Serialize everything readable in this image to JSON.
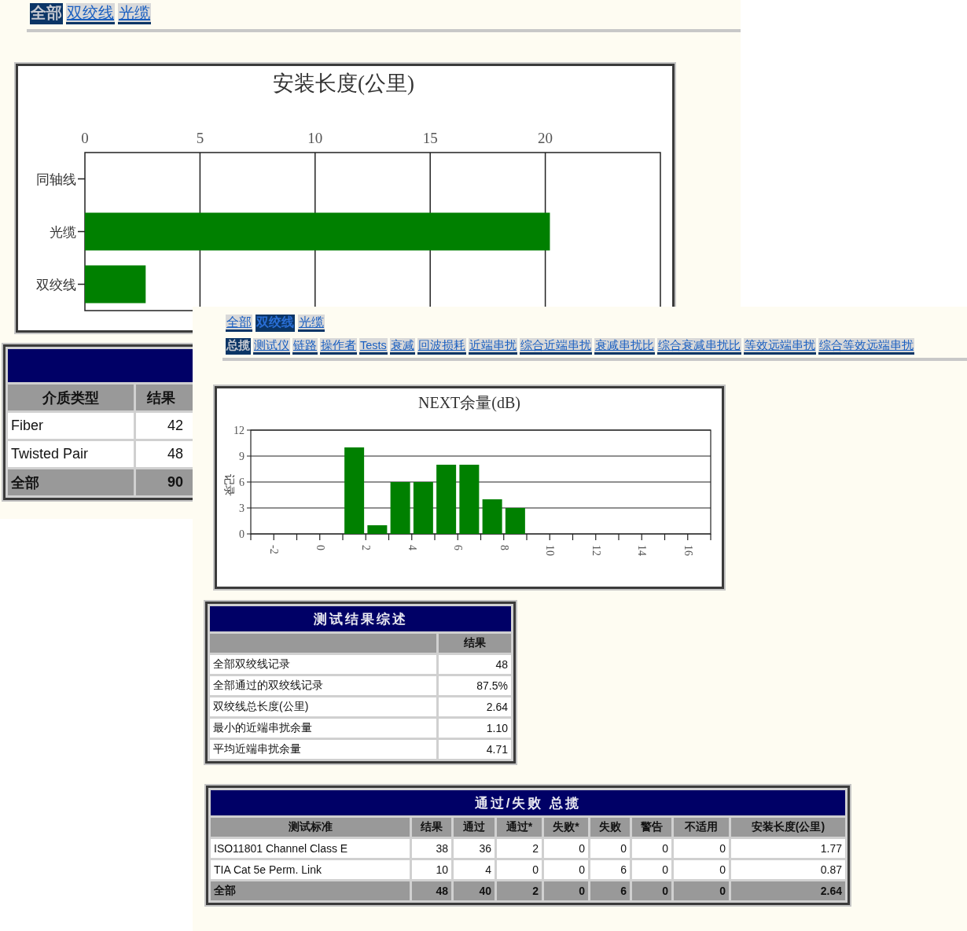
{
  "back_window": {
    "tabs": [
      {
        "label": "全部",
        "selected": true
      },
      {
        "label": "双绞线",
        "selected": false
      },
      {
        "label": "光缆",
        "selected": false
      }
    ],
    "chart": {
      "chart_data": {
        "type": "bar",
        "orientation": "horizontal",
        "title": "安装长度(公里)",
        "categories": [
          "同轴线",
          "光缆",
          "双绞线"
        ],
        "values": [
          0,
          20.2,
          2.64
        ],
        "xlim": [
          0,
          25
        ],
        "xticks": [
          0,
          5,
          10,
          15,
          20
        ],
        "grid": true
      }
    },
    "media_table": {
      "columns": [
        "介质类型",
        "结果"
      ],
      "rows": [
        [
          "Fiber",
          "42"
        ],
        [
          "Twisted Pair",
          "48"
        ]
      ],
      "total": [
        "全部",
        "90"
      ]
    }
  },
  "front_window": {
    "tabs": [
      {
        "label": "全部",
        "selected": false
      },
      {
        "label": "双绞线",
        "selected": true
      },
      {
        "label": "光缆",
        "selected": false
      }
    ],
    "subtabs": [
      {
        "label": "总揽",
        "selected": true
      },
      {
        "label": "测试仪",
        "selected": false
      },
      {
        "label": "链路",
        "selected": false
      },
      {
        "label": "操作者",
        "selected": false
      },
      {
        "label": "Tests",
        "selected": false
      },
      {
        "label": "衰减",
        "selected": false
      },
      {
        "label": "回波损耗",
        "selected": false
      },
      {
        "label": "近端串扰",
        "selected": false
      },
      {
        "label": "综合近端串扰",
        "selected": false
      },
      {
        "label": "衰减串扰比",
        "selected": false
      },
      {
        "label": "综合衰减串扰比",
        "selected": false
      },
      {
        "label": "等效远端串扰",
        "selected": false
      },
      {
        "label": "综合等效远端串扰",
        "selected": false
      }
    ],
    "chart": {
      "chart_data": {
        "type": "bar",
        "title": "NEXT余量(dB)",
        "ylabel": "记录",
        "x": [
          1.5,
          2.5,
          3.5,
          4.5,
          5.5,
          6.5,
          7.5,
          8.5
        ],
        "values": [
          10,
          1,
          6,
          6,
          8,
          8,
          4,
          3
        ],
        "xlim": [
          -3,
          17
        ],
        "ylim": [
          0,
          12
        ],
        "xticks": [
          -2,
          0,
          2,
          4,
          6,
          8,
          10,
          12,
          14,
          16
        ],
        "yticks": [
          0,
          3,
          6,
          9,
          12
        ],
        "grid": true
      }
    },
    "summary_table": {
      "title": "测试结果综述",
      "result_header": "结果",
      "rows": [
        [
          "全部双绞线记录",
          "48"
        ],
        [
          "全部通过的双绞线记录",
          "87.5%"
        ],
        [
          "双绞线总长度(公里)",
          "2.64"
        ],
        [
          "最小的近端串扰余量",
          "1.10"
        ],
        [
          "平均近端串扰余量",
          "4.71"
        ]
      ]
    },
    "pass_fail_table": {
      "title": "通过/失败 总揽",
      "columns": [
        "测试标准",
        "结果",
        "通过",
        "通过*",
        "失败*",
        "失败",
        "警告",
        "不适用",
        "安装长度(公里)"
      ],
      "rows": [
        [
          "ISO11801 Channel Class E",
          "38",
          "36",
          "2",
          "0",
          "0",
          "0",
          "0",
          "1.77"
        ],
        [
          "TIA Cat 5e Perm. Link",
          "10",
          "4",
          "0",
          "0",
          "6",
          "0",
          "0",
          "0.87"
        ]
      ],
      "total": [
        "全部",
        "48",
        "40",
        "2",
        "0",
        "6",
        "0",
        "0",
        "2.64"
      ]
    }
  }
}
